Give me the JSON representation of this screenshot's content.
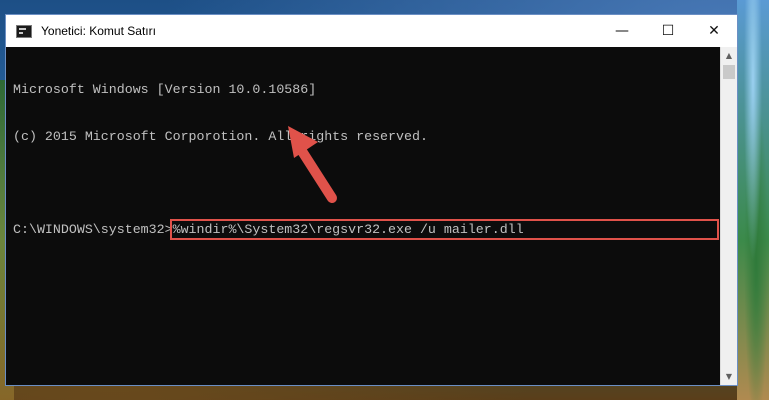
{
  "window": {
    "title": "Yonetici: Komut Satırı",
    "minimize": "—",
    "maximize": "☐",
    "close": "✕"
  },
  "console": {
    "line1": "Microsoft Windows [Version 10.0.10586]",
    "line2": "(c) 2015 Microsoft Corporotion. All rights reserved.",
    "prompt": "C:\\WINDOWS\\system32>",
    "command": "%windir%\\System32\\regsvr32.exe /u mailer.dll"
  },
  "annotation": {
    "highlight_color": "#e0524a",
    "arrow_color": "#e0524a"
  },
  "icons": {
    "app": "cmd-icon",
    "scroll_up": "▲",
    "scroll_down": "▼"
  }
}
